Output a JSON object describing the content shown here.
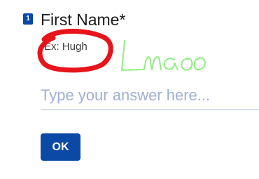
{
  "question": {
    "number": "1",
    "title": "First Name*",
    "hint": "Ex: Hugh",
    "accent_color": "#0b49a7"
  },
  "answer_input": {
    "value": "",
    "placeholder": "Type your answer here..."
  },
  "submit_button": {
    "label": "OK"
  },
  "annotations": {
    "circle_color": "#e8141c",
    "scribble_text": "Lmao",
    "scribble_color": "#8ef07f"
  }
}
